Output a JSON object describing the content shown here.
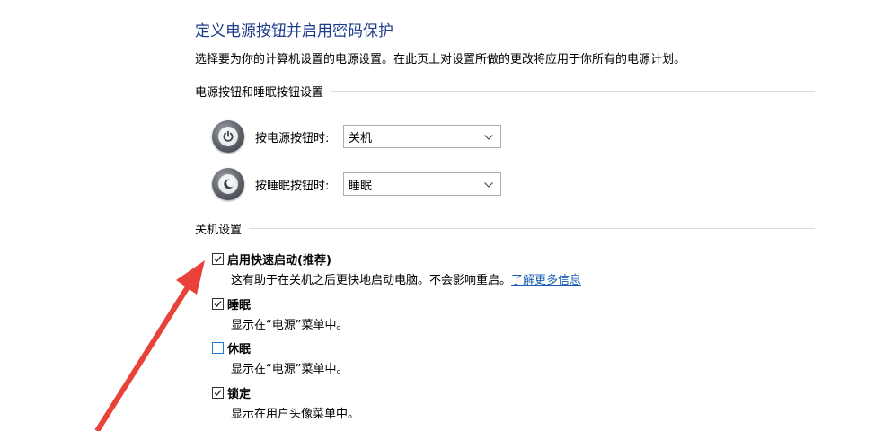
{
  "header": {
    "title": "定义电源按钮并启用密码保护",
    "description": "选择要为你的计算机设置的电源设置。在此页上对设置所做的更改将应用于你所有的电源计划。"
  },
  "power_buttons_group": {
    "label": "电源按钮和睡眠按钮设置",
    "rows": [
      {
        "label": "按电源按钮时:",
        "value": "关机",
        "icon": "power-button-icon"
      },
      {
        "label": "按睡眠按钮时:",
        "value": "睡眠",
        "icon": "sleep-button-icon"
      }
    ]
  },
  "shutdown_group": {
    "label": "关机设置",
    "options": [
      {
        "label": "启用快速启动(推荐)",
        "checked": true,
        "description": "这有助于在关机之后更快地启动电脑。不会影响重启。",
        "link": "了解更多信息"
      },
      {
        "label": "睡眠",
        "checked": true,
        "description": "显示在“电源”菜单中。"
      },
      {
        "label": "休眠",
        "checked": false,
        "description": "显示在“电源”菜单中。"
      },
      {
        "label": "锁定",
        "checked": true,
        "description": "显示在用户头像菜单中。"
      }
    ]
  },
  "annotation": {
    "arrow_color": "#e8423a"
  }
}
